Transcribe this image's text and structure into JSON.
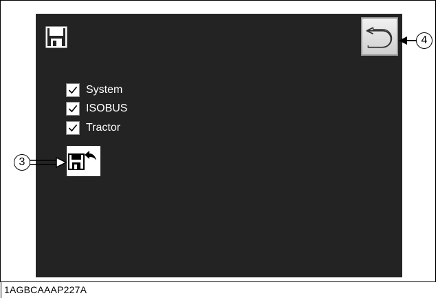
{
  "screen": {
    "header_icon": "floppy-disk-icon",
    "back_button": {
      "icon": "return-arrow-icon"
    },
    "checklist": [
      {
        "label": "System",
        "checked": true
      },
      {
        "label": "ISOBUS",
        "checked": true
      },
      {
        "label": "Tractor",
        "checked": true
      }
    ],
    "restore_button": {
      "icon": "save-restore-icon"
    }
  },
  "callouts": {
    "restore": "3",
    "back": "4"
  },
  "caption": "1AGBCAAAP227A",
  "colors": {
    "screen_bg": "#232323",
    "button_bg": "#e6e6e6",
    "text": "#ffffff"
  }
}
